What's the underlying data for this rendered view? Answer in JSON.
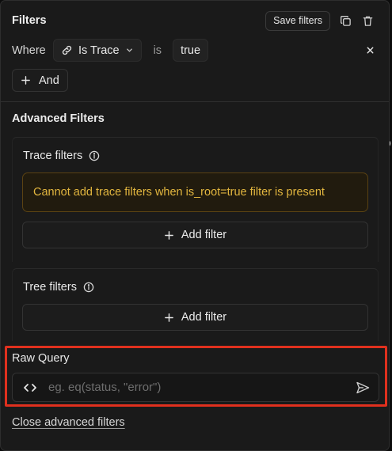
{
  "header": {
    "title": "Filters",
    "save_label": "Save filters"
  },
  "condition": {
    "where_label": "Where",
    "field": "Is Trace",
    "operator": "is",
    "value": "true"
  },
  "and_label": "And",
  "advanced": {
    "title": "Advanced Filters",
    "trace_filters": {
      "label": "Trace filters",
      "warning": "Cannot add trace filters when is_root=true filter is present",
      "add_label": "Add filter"
    },
    "tree_filters": {
      "label": "Tree filters",
      "add_label": "Add filter"
    },
    "raw_query": {
      "label": "Raw Query",
      "placeholder": "eg. eq(status, \"error\")",
      "value": ""
    },
    "close_label": "Close advanced filters"
  },
  "background_glyph": "o",
  "colors": {
    "warning_text": "#e2b63f",
    "warning_border": "#5a4212",
    "highlight_border": "#e0301e"
  },
  "icons": [
    "copy-icon",
    "trash-icon",
    "link-icon",
    "chevron-down-icon",
    "close-icon",
    "plus-icon",
    "info-icon",
    "code-icon",
    "send-icon"
  ]
}
